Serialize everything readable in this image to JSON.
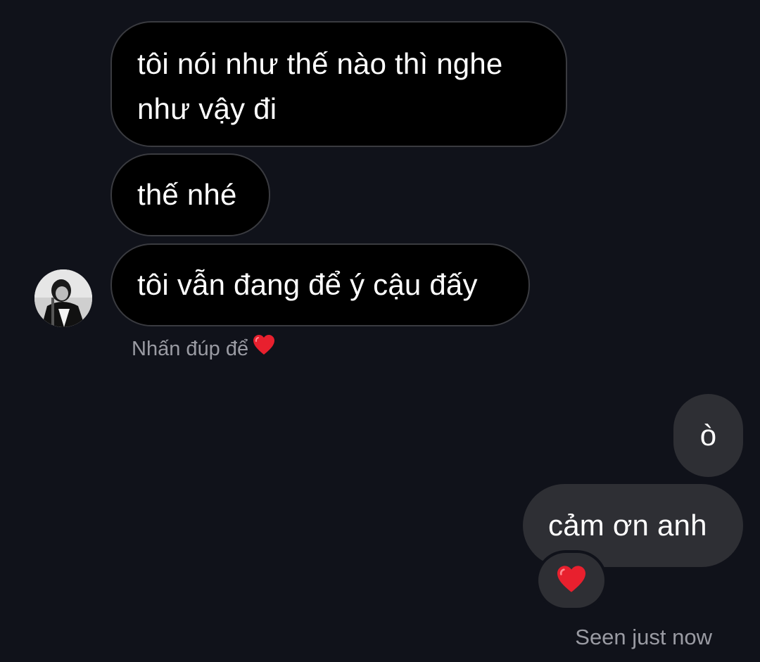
{
  "thread": {
    "incoming": [
      {
        "text": "tôi nói như thế nào thì nghe như vậy đi"
      },
      {
        "text": "thế nhé"
      },
      {
        "text": "tôi vẫn đang để ý cậu đấy"
      }
    ],
    "like_hint": "Nhấn đúp để",
    "outgoing": [
      {
        "text": "ò"
      },
      {
        "text": "cảm ơn anh"
      }
    ],
    "reaction_icon": "red-heart-icon",
    "seen_status": "Seen just now"
  },
  "colors": {
    "background": "#10121a",
    "incoming_bubble": "#000000",
    "outgoing_bubble": "#2e2f34",
    "heart": "#e8202e",
    "meta_text": "#9a9ba3"
  }
}
